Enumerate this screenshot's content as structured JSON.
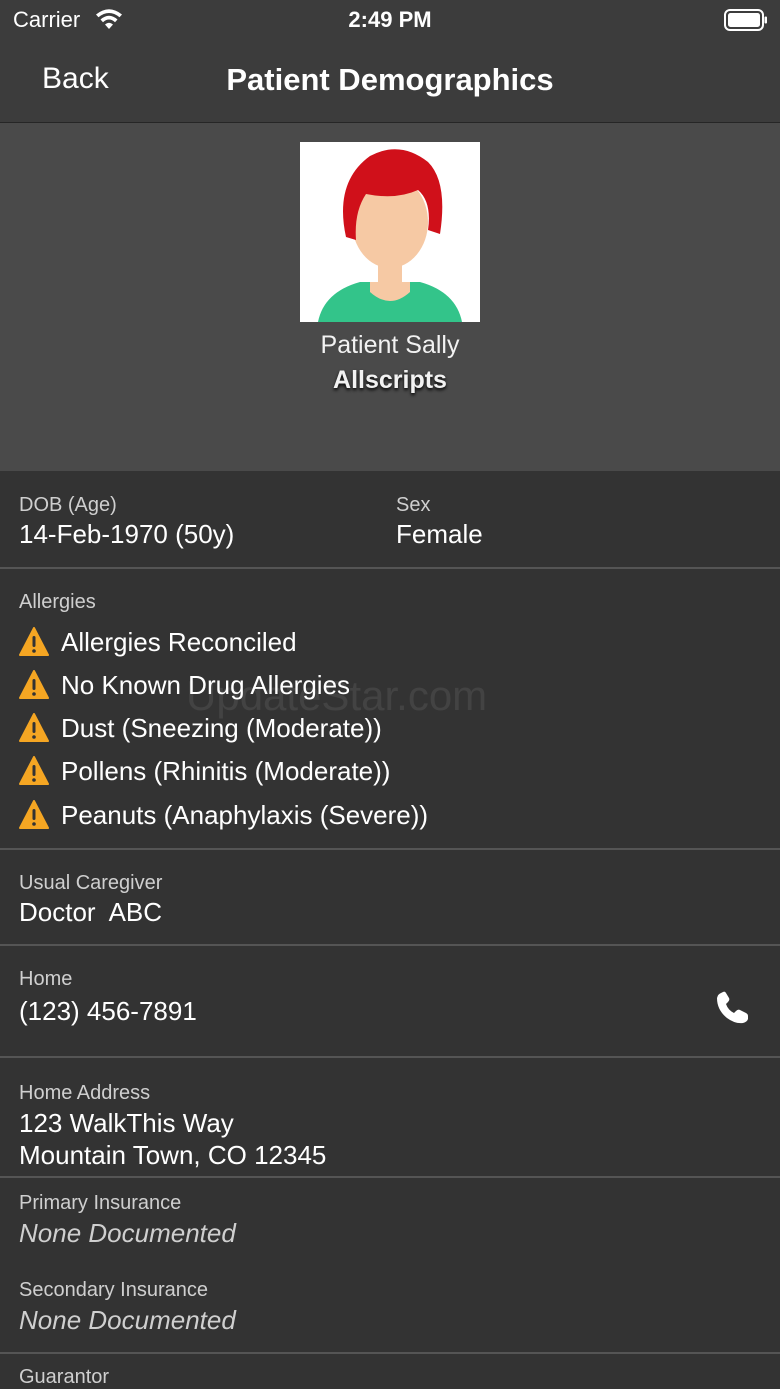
{
  "status": {
    "carrier": "Carrier",
    "time": "2:49 PM"
  },
  "nav": {
    "back_label": "Back",
    "title": "Patient Demographics"
  },
  "patient": {
    "name": "Patient Sally",
    "org": "Allscripts"
  },
  "demographics": {
    "dob_label": "DOB (Age)",
    "dob_value": "14-Feb-1970 (50y)",
    "sex_label": "Sex",
    "sex_value": "Female"
  },
  "allergies": {
    "label": "Allergies",
    "items": [
      "Allergies Reconciled",
      "No Known Drug Allergies",
      "Dust (Sneezing (Moderate))",
      "Pollens (Rhinitis (Moderate))",
      "Peanuts (Anaphylaxis (Severe))"
    ]
  },
  "caregiver": {
    "label": "Usual Caregiver",
    "value": "Doctor  ABC"
  },
  "home_phone": {
    "label": "Home",
    "value": "(123) 456-7891"
  },
  "address": {
    "label": "Home Address",
    "line1": "123 WalkThis Way",
    "line2": "Mountain Town, CO 12345"
  },
  "insurance": {
    "primary_label": "Primary Insurance",
    "primary_value": "None Documented",
    "secondary_label": "Secondary Insurance",
    "secondary_value": "None Documented"
  },
  "guarantor": {
    "label": "Guarantor"
  },
  "watermark": "UpdateStar.com",
  "colors": {
    "background": "#333333",
    "header": "#4a4a4a",
    "warning": "#f5a623",
    "hair": "#d0101a",
    "shirt": "#33c48a",
    "skin": "#f6c9a4"
  }
}
